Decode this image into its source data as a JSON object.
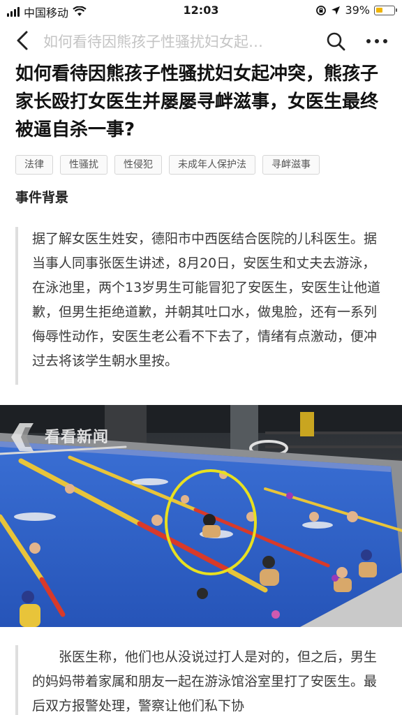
{
  "status_bar": {
    "carrier": "中国移动",
    "time": "12:03",
    "battery": "39%",
    "battery_level": 0.39
  },
  "nav": {
    "title": "如何看待因熊孩子性骚扰妇女起…",
    "icons": [
      "back-arrow-icon",
      "search-icon",
      "more-icon"
    ]
  },
  "question": {
    "title": "如何看待因熊孩子性骚扰妇女起冲突，熊孩子家长殴打女医生并屡屡寻衅滋事，女医生最终被逼自杀一事?"
  },
  "tags": [
    "法律",
    "性骚扰",
    "性侵犯",
    "未成年人保护法",
    "寻衅滋事"
  ],
  "answer": {
    "section_heading": "事件背景",
    "quote_1": "据了解女医生姓安，德阳市中西医结合医院的儿科医生。据当事人同事张医生讲述，8月20日，安医生和丈夫去游泳，在泳池里，两个13岁男生可能冒犯了安医生，安医生让他道歉，但男生拒绝道歉，并朝其吐口水，做鬼脸，还有一系列侮辱性动作，安医生老公看不下去了，情绪有点激动，便冲过去将该学生朝水里按。",
    "image": {
      "watermark": "看看新闻"
    },
    "quote_2": "张医生称，他们也从没说过打人是对的，但之后，男生的妈妈带着家属和朋友一起在游泳馆浴室里打了安医生。最后双方报警处理，警察让他们私下协"
  },
  "colors": {
    "pool_water": "#2f63c8",
    "highlight_circle": "#e8e020",
    "lane_rope_red": "#d83a2a",
    "lane_rope_yellow": "#e8c43a"
  }
}
